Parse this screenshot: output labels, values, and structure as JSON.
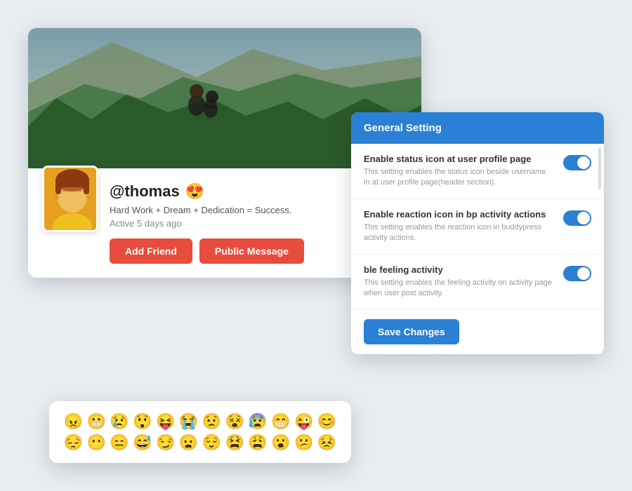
{
  "profile": {
    "username": "@thomas",
    "emoji": "😍",
    "bio": "Hard Work + Dream + Dedication = Success.",
    "active": "Active 5 days ago",
    "add_friend_label": "Add Friend",
    "public_message_label": "Public Message"
  },
  "emojis": [
    "😠",
    "😬",
    "😢",
    "😲",
    "😝",
    "😭",
    "😟",
    "😵",
    "😰",
    "😁",
    "😜",
    "😊",
    "😔",
    "😶",
    "😑",
    "😅",
    "😏",
    "😦",
    "😌",
    "😫",
    "😩",
    "😮",
    "😕",
    "😣"
  ],
  "settings": {
    "title": "General Setting",
    "rows": [
      {
        "label": "Enable status icon at user profile page",
        "desc": "This setting enables the status icon beside username in at user profile page(header section).",
        "enabled": true
      },
      {
        "label": "Enable reaction icon in bp activity actions",
        "desc": "This setting enables the reaction icon in buddypress activity actions.",
        "enabled": true
      },
      {
        "label": "ble feeling activity",
        "desc": "This setting enables the feeling activity on activity page when user post activity.",
        "enabled": true
      }
    ],
    "save_label": "Save Changes"
  }
}
